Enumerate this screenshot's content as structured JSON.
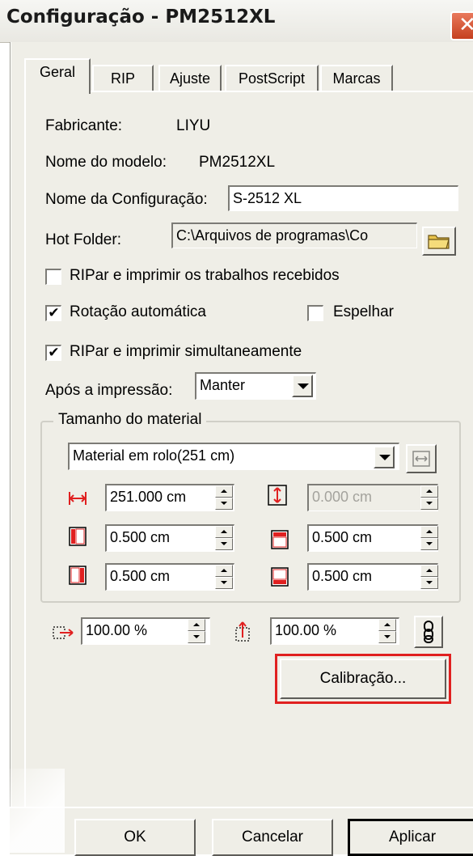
{
  "window": {
    "title": "Configuração - PM2512XL",
    "close_glyph": "✕"
  },
  "tabs": [
    {
      "label": "Geral",
      "active": true
    },
    {
      "label": "RIP"
    },
    {
      "label": "Ajuste"
    },
    {
      "label": "PostScript"
    },
    {
      "label": "Marcas"
    }
  ],
  "general": {
    "manufacturer_label": "Fabricante:",
    "manufacturer_value": "LIYU",
    "model_label": "Nome do modelo:",
    "model_value": "PM2512XL",
    "config_name_label": "Nome da Configuração:",
    "config_name_value": "S-2512 XL",
    "hot_folder_label": "Hot Folder:",
    "hot_folder_value": "C:\\Arquivos de programas\\Co",
    "rip_print_received": {
      "label": "RIPar e imprimir os trabalhos recebidos",
      "checked": false
    },
    "auto_rotation": {
      "label": "Rotação automática",
      "checked": true
    },
    "mirror": {
      "label": "Espelhar",
      "checked": false
    },
    "rip_print_simultaneous": {
      "label": "RIPar e imprimir simultaneamente",
      "checked": true
    },
    "after_print_label": "Após a impressão:",
    "after_print_value": "Manter"
  },
  "media_size": {
    "group_title": "Tamanho do material",
    "media_select": "Material em rolo(251 cm)",
    "width_value": "251.000 cm",
    "height_value": "0.000 cm",
    "margin_left": "0.500 cm",
    "margin_right": "0.500 cm",
    "margin_top": "0.500 cm",
    "margin_bottom": "0.500 cm"
  },
  "scale": {
    "horizontal": "100.00 %",
    "vertical": "100.00 %"
  },
  "calibration_button": "Calibração...",
  "footer": {
    "ok": "OK",
    "cancel": "Cancelar",
    "apply": "Aplicar"
  },
  "colors": {
    "dialog_bg": "#efeee7",
    "highlight": "#e02020",
    "close_button": "#c5401f",
    "width_icon": "#e02020"
  }
}
